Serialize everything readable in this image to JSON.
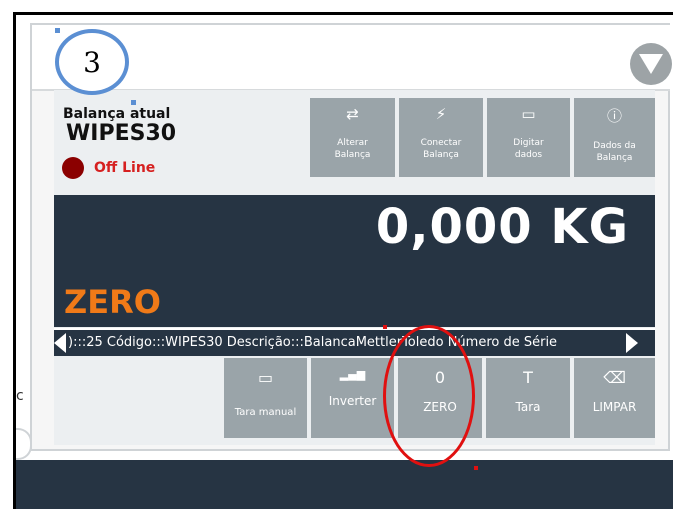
{
  "step_number": "3",
  "current_scale": {
    "label": "Balança atual",
    "name": "WIPES30",
    "status": "Off Line"
  },
  "top_buttons": [
    {
      "icon": "swap-icon",
      "glyph": "⇄",
      "label_line1": "Alterar",
      "label_line2": "Balança"
    },
    {
      "icon": "lightning-icon",
      "glyph": "⚡",
      "label_line1": "Conectar",
      "label_line2": "Balança"
    },
    {
      "icon": "keyboard-icon",
      "glyph": "▭",
      "label_line1": "Digitar",
      "label_line2": "dados"
    },
    {
      "icon": "info-icon",
      "glyph": "ⓘ",
      "label_line1": "Dados da",
      "label_line2": "Balança"
    }
  ],
  "weight_display": "0,000 KG",
  "weight_status": "ZERO",
  "ticker": "):::25  Código:::WIPES30          Descrição:::BalancaMettlerToledo   Número de Série",
  "bottom_buttons": [
    {
      "icon": "keyboard-icon",
      "glyph": "▭",
      "label": "Tara manual"
    },
    {
      "icon": "bar-chart-icon",
      "glyph": "▂▄▆",
      "label": "Inverter"
    },
    {
      "icon": "zero-icon",
      "glyph": "0",
      "label": "ZERO"
    },
    {
      "icon": "tare-icon",
      "glyph": "T",
      "label": "Tara"
    },
    {
      "icon": "backspace-icon",
      "glyph": "⌫",
      "label": "LIMPAR"
    }
  ],
  "cut_text": "c",
  "colors": {
    "tile": "#9aa4a9",
    "display_bg": "#263443",
    "status_red": "#d62020",
    "status_orange": "#f07a18",
    "annotation_red": "#e01010",
    "annotation_blue": "#5b8fd3"
  }
}
